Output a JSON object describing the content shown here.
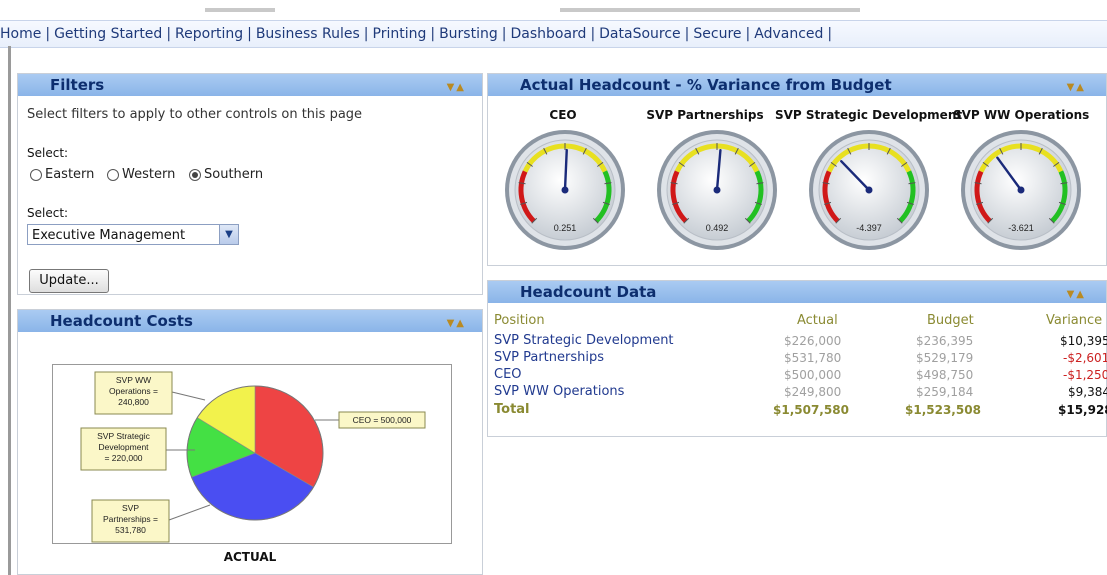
{
  "nav": {
    "items": [
      "Home",
      "Getting Started",
      "Reporting",
      "Business Rules",
      "Printing",
      "Bursting",
      "Dashboard",
      "DataSource",
      "Secure",
      "Advanced"
    ],
    "separator": "|"
  },
  "filters": {
    "title": "Filters",
    "description": "Select filters to apply to other controls on this page",
    "select_label_1": "Select:",
    "radios": [
      {
        "label": "Eastern",
        "checked": false
      },
      {
        "label": "Western",
        "checked": false
      },
      {
        "label": "Southern",
        "checked": true
      }
    ],
    "select_label_2": "Select:",
    "dropdown_value": "Executive Management",
    "update_button": "Update..."
  },
  "gauges": {
    "title": "Actual Headcount - % Variance from Budget",
    "items": [
      {
        "title": "CEO",
        "value": "0.251",
        "needle": 0.251
      },
      {
        "title": "SVP Partnerships",
        "value": "0.492",
        "needle": 0.492
      },
      {
        "title": "SVP Strategic Development",
        "value": "-4.397",
        "needle": -4.397
      },
      {
        "title": "SVP WW Operations",
        "value": "-3.621",
        "needle": -3.621
      }
    ]
  },
  "costs": {
    "title": "Headcount Costs",
    "chart_label": "ACTUAL",
    "callouts": [
      "SVP WW Operations = 240,800",
      "SVP Strategic Development = 220,000",
      "SVP Partnerships = 531,780",
      "CEO = 500,000"
    ]
  },
  "chart_data": {
    "type": "pie",
    "title": "ACTUAL",
    "categories": [
      "CEO",
      "SVP Partnerships",
      "SVP Strategic Development",
      "SVP WW Operations"
    ],
    "values": [
      500000,
      531780,
      220000,
      240800
    ],
    "colors": [
      "#ee4444",
      "#4a4ef2",
      "#44e044",
      "#f2f24c"
    ]
  },
  "headcount": {
    "title": "Headcount Data",
    "headers": [
      "Position",
      "Actual",
      "Budget",
      "Variance"
    ],
    "rows": [
      [
        "SVP Strategic Development",
        "$226,000",
        "$236,395",
        "$10,395"
      ],
      [
        "SVP Partnerships",
        "$531,780",
        "$529,179",
        "-$2,601"
      ],
      [
        "CEO",
        "$500,000",
        "$498,750",
        "-$1,250"
      ],
      [
        "SVP WW Operations",
        "$249,800",
        "$259,184",
        "$9,384"
      ]
    ],
    "total": [
      "Total",
      "$1,507,580",
      "$1,523,508",
      "$15,928"
    ]
  },
  "icons": {
    "collapse": "triangle-down-icon",
    "expand": "triangle-up-icon"
  }
}
